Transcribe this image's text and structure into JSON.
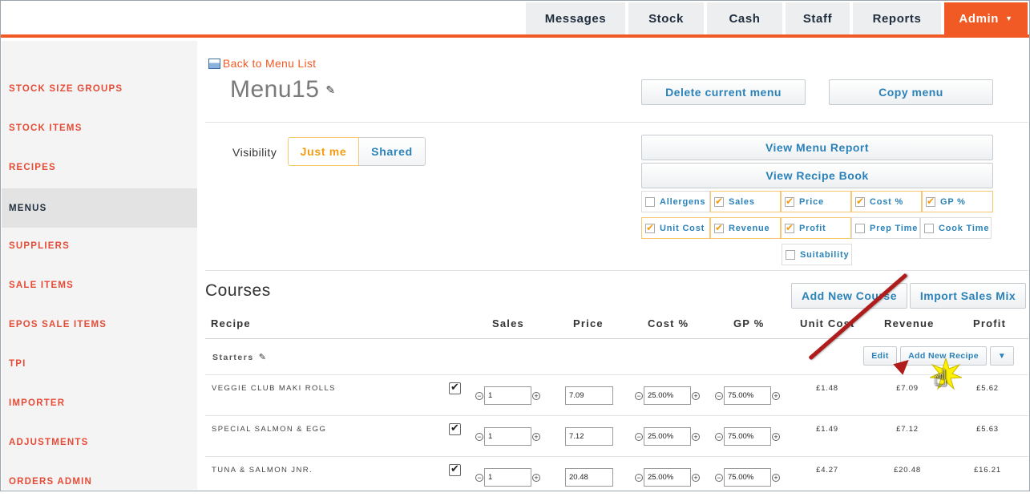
{
  "topnav": {
    "items": [
      "Messages",
      "Stock",
      "Cash",
      "Staff",
      "Reports"
    ],
    "admin": "Admin"
  },
  "sidebar": {
    "items": [
      "STOCK SIZE GROUPS",
      "STOCK ITEMS",
      "RECIPES",
      "MENUS",
      "SUPPLIERS",
      "SALE ITEMS",
      "EPOS SALE ITEMS",
      "TPI",
      "IMPORTER",
      "ADJUSTMENTS",
      "ORDERS ADMIN"
    ],
    "active": "MENUS"
  },
  "page": {
    "back_link": "Back to Menu List",
    "title": "Menu15",
    "delete_btn": "Delete current menu",
    "copy_btn": "Copy menu",
    "visibility_label": "Visibility",
    "vis_just_me": "Just me",
    "vis_shared": "Shared",
    "view_report_btn": "View Menu Report",
    "view_book_btn": "View Recipe Book"
  },
  "columns_toggles": {
    "row1": [
      {
        "label": "Allergens",
        "checked": false
      },
      {
        "label": "Sales",
        "checked": true
      },
      {
        "label": "Price",
        "checked": true
      },
      {
        "label": "Cost %",
        "checked": true
      },
      {
        "label": "GP %",
        "checked": true
      }
    ],
    "row2": [
      {
        "label": "Unit Cost",
        "checked": true
      },
      {
        "label": "Revenue",
        "checked": true
      },
      {
        "label": "Profit",
        "checked": true
      },
      {
        "label": "Prep Time",
        "checked": false
      },
      {
        "label": "Cook Time",
        "checked": false
      }
    ],
    "row3": [
      {
        "label": "Suitability",
        "checked": false
      }
    ]
  },
  "courses": {
    "heading": "Courses",
    "add_course_btn": "Add New Course",
    "import_btn": "Import Sales Mix",
    "headers": [
      "Recipe",
      "Sales",
      "Price",
      "Cost %",
      "GP %",
      "Unit Cost",
      "Revenue",
      "Profit"
    ],
    "group_name": "Starters",
    "edit_btn": "Edit",
    "add_recipe_btn": "Add New Recipe",
    "dropdown_icon": "▼",
    "rows": [
      {
        "name": "VEGGIE CLUB MAKI ROLLS",
        "sales": "1",
        "price": "7.09",
        "cost": "25.00%",
        "gp": "75.00%",
        "unit_cost": "£1.48",
        "revenue": "£7.09",
        "profit": "£5.62"
      },
      {
        "name": "SPECIAL SALMON & EGG",
        "sales": "1",
        "price": "7.12",
        "cost": "25.00%",
        "gp": "75.00%",
        "unit_cost": "£1.49",
        "revenue": "£7.12",
        "profit": "£5.63"
      },
      {
        "name": "TUNA & SALMON JNR.",
        "sales": "1",
        "price": "20.48",
        "cost": "25.00%",
        "gp": "75.00%",
        "unit_cost": "£4.27",
        "revenue": "£20.48",
        "profit": "£16.21"
      }
    ]
  },
  "colors": {
    "accent": "#f15a24",
    "link_blue": "#2a82b8",
    "check_orange": "#f39c12",
    "arrow": "#b01c1c"
  }
}
